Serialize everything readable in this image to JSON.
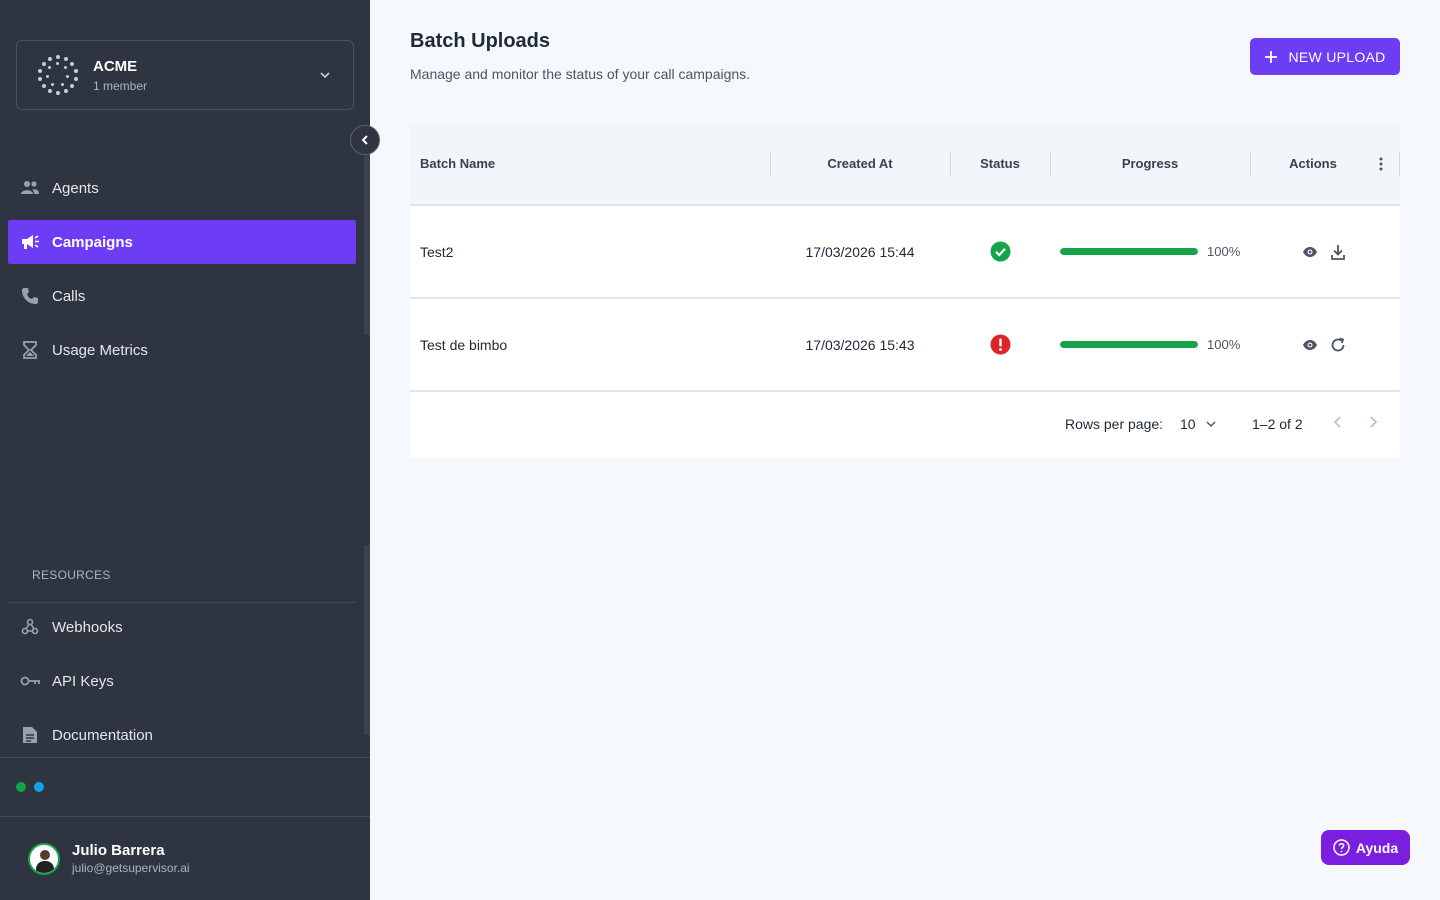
{
  "org": {
    "name": "ACME",
    "members": "1 member"
  },
  "nav": [
    {
      "label": "Agents",
      "icon": "people-icon"
    },
    {
      "label": "Campaigns",
      "icon": "megaphone-icon",
      "active": true
    },
    {
      "label": "Calls",
      "icon": "phone-icon"
    },
    {
      "label": "Usage Metrics",
      "icon": "hourglass-icon"
    }
  ],
  "resources": {
    "title": "RESOURCES",
    "items": [
      {
        "label": "Webhooks",
        "icon": "webhook-icon"
      },
      {
        "label": "API Keys",
        "icon": "key-icon"
      },
      {
        "label": "Documentation",
        "icon": "document-icon"
      }
    ]
  },
  "status_dots": [
    "#16a34a",
    "#0ea5e9"
  ],
  "user": {
    "name": "Julio Barrera",
    "email": "julio@getsupervisor.ai"
  },
  "page": {
    "title": "Batch Uploads",
    "subtitle": "Manage and monitor the status of your call campaigns.",
    "new_button": "NEW UPLOAD"
  },
  "table": {
    "columns": [
      "Batch Name",
      "Created At",
      "Status",
      "Progress",
      "Actions"
    ],
    "rows": [
      {
        "name": "Test2",
        "created_at": "17/03/2026 15:44",
        "status": "success",
        "progress": 100,
        "progress_label": "100%",
        "actions": [
          "view-icon",
          "download-icon"
        ]
      },
      {
        "name": "Test de bimbo",
        "created_at": "17/03/2026 15:43",
        "status": "error",
        "progress": 100,
        "progress_label": "100%",
        "actions": [
          "view-icon",
          "retry-icon"
        ]
      }
    ],
    "footer": {
      "rows_per_page_label": "Rows per page:",
      "rows_per_page": "10",
      "range": "1–2 of 2"
    }
  },
  "help_button": "Ayuda",
  "colors": {
    "accent": "#6d3cf5",
    "sidebar": "#2e3440",
    "success": "#16a34a",
    "error": "#dc2626",
    "help": "#7c1ee0"
  }
}
